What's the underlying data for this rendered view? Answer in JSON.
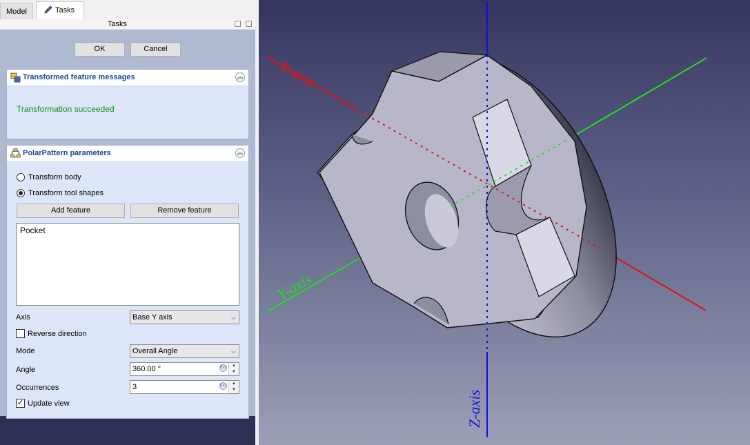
{
  "tabs": {
    "model": "Model",
    "tasks": "Tasks"
  },
  "panel_title": "Tasks",
  "buttons": {
    "ok": "OK",
    "cancel": "Cancel"
  },
  "messages_box": {
    "title": "Transformed feature messages",
    "message": "Transformation succeeded"
  },
  "polar_pattern": {
    "title": "PolarPattern parameters",
    "radio_transform_body": "Transform body",
    "radio_transform_tool": "Transform tool shapes",
    "selected_radio": "transform_tool",
    "add_feature": "Add feature",
    "remove_feature": "Remove feature",
    "features": [
      "Pocket"
    ],
    "axis_label": "Axis",
    "axis_value": "Base Y axis",
    "reverse_label": "Reverse direction",
    "reverse_checked": false,
    "mode_label": "Mode",
    "mode_value": "Overall Angle",
    "angle_label": "Angle",
    "angle_value": "360.00 °",
    "occurrences_label": "Occurrences",
    "occurrences_value": "3",
    "update_view_label": "Update view",
    "update_view_checked": true
  },
  "viewport": {
    "x_axis_label": "X-axis",
    "y_axis_label": "Y-axis",
    "z_axis_label": "Z-axis",
    "x_color": "#e01010",
    "y_color": "#22dd22",
    "z_color": "#1010e0"
  }
}
